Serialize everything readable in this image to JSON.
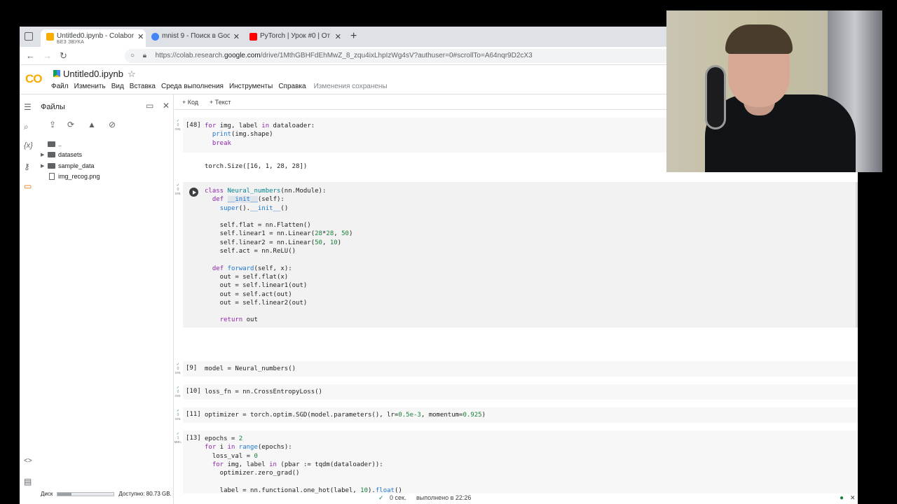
{
  "browser": {
    "tabs": [
      {
        "title": "Untitled0.ipynb - Colabor",
        "subtitle": "БЕЗ ЗВУКА",
        "active": true
      },
      {
        "title": "mnist 9 - Поиск в Google",
        "active": false
      },
      {
        "title": "PyTorch | Урок #0 | От А",
        "active": false
      }
    ],
    "url_prefix": "https://colab.research.",
    "url_domain": "google.com",
    "url_suffix": "/drive/1MthGBHFdEhMwZ_8_zqu4ixLhpIzWg4sV?authuser=0#scrollTo=A64nqr9D2cX3"
  },
  "colab": {
    "logo": "CO",
    "notebook_title": "Untitled0.ipynb",
    "menus": [
      "Файл",
      "Изменить",
      "Вид",
      "Вставка",
      "Среда выполнения",
      "Инструменты",
      "Справка"
    ],
    "saved_status": "Изменения сохранены",
    "add_code": "+ Код",
    "add_text": "+ Текст"
  },
  "files_panel": {
    "title": "Файлы",
    "items": [
      {
        "name": "..",
        "type": "folder"
      },
      {
        "name": "datasets",
        "type": "folder"
      },
      {
        "name": "sample_data",
        "type": "folder"
      },
      {
        "name": "img_recog.png",
        "type": "file"
      }
    ],
    "disk_label": "Диск",
    "disk_used_fraction": 0.25,
    "disk_available": "Доступно: 80.73 GB."
  },
  "cells": {
    "c48": {
      "count": "[48]",
      "gutter": "0 сек.",
      "output": "torch.Size([16, 1, 28, 28])"
    },
    "cls": {
      "gutter": "0 сек."
    },
    "c9": {
      "count": "[9]",
      "gutter": "0 сек."
    },
    "c10": {
      "count": "[10]",
      "gutter": "0 сек."
    },
    "c11": {
      "count": "[11]",
      "gutter": "0 сек."
    },
    "c13": {
      "count": "[13]",
      "gutter": "1 мин."
    }
  },
  "status_bar": {
    "duration": "0 сек.",
    "completed": "выполнено в 22:26"
  },
  "colors": {
    "accent": "#f9ab00",
    "check": "#188038",
    "keyword": "#8e24aa",
    "function": "#1976d2"
  }
}
